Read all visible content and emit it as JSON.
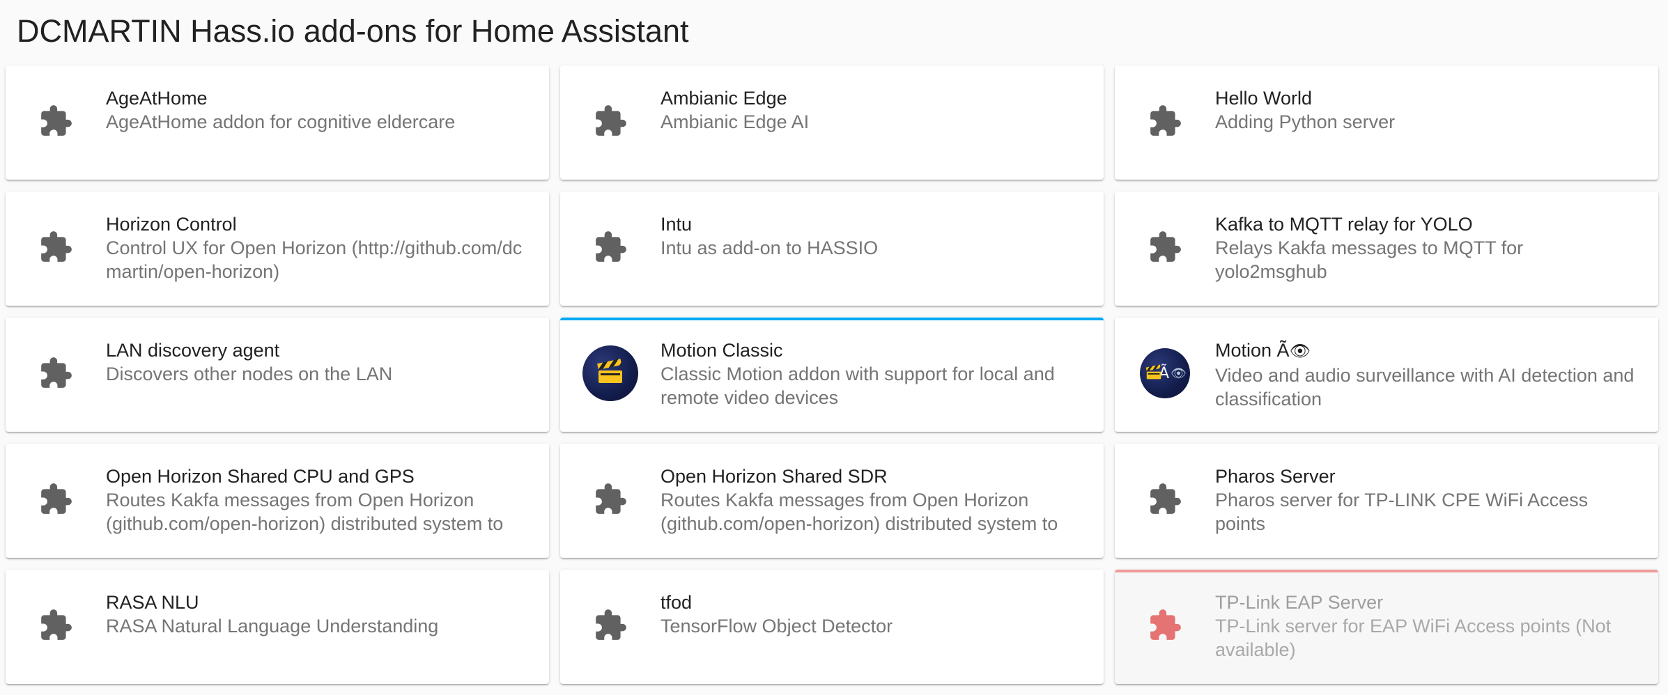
{
  "page": {
    "title": "DCMARTIN Hass.io add-ons for Home Assistant"
  },
  "colors": {
    "update_indicator": "#03a9f4",
    "unavailable_indicator": "#ef9a9a",
    "icon_default": "#616161",
    "icon_unavailable": "#e57373"
  },
  "addons": [
    {
      "name": "AgeAtHome",
      "description": "AgeAtHome addon for cognitive eldercare",
      "icon": "puzzle-icon"
    },
    {
      "name": "Ambianic Edge",
      "description": "Ambianic Edge AI",
      "icon": "puzzle-icon"
    },
    {
      "name": "Hello World",
      "description": "Adding Python server",
      "icon": "puzzle-icon"
    },
    {
      "name": "Horizon Control",
      "description": "Control UX for Open Horizon (http://github.com/dcmartin/open-horizon)",
      "icon": "puzzle-icon"
    },
    {
      "name": "Intu",
      "description": "Intu as add-on to HASSIO",
      "icon": "puzzle-icon"
    },
    {
      "name": "Kafka to MQTT relay for YOLO",
      "description": "Relays Kakfa messages to MQTT for yolo2msghub",
      "icon": "puzzle-icon"
    },
    {
      "name": "LAN discovery agent",
      "description": "Discovers other nodes on the LAN",
      "icon": "puzzle-icon"
    },
    {
      "name": "Motion Classic",
      "description": "Classic Motion addon with support for local and remote video devices",
      "icon": "motion-logo-icon",
      "status": "update-available"
    },
    {
      "name": "Motion Ã",
      "name_emoji": "👁",
      "description": "Video and audio surveillance with AI detection and classification",
      "icon": "motion-ai-logo-icon",
      "logo_text": "Ã",
      "logo_emoji": "👁"
    },
    {
      "name": "Open Horizon Shared CPU and GPS",
      "description": "Routes Kakfa messages from Open Horizon (github.com/open-horizon) distributed system to",
      "icon": "puzzle-icon"
    },
    {
      "name": "Open Horizon Shared SDR",
      "description": "Routes Kakfa messages from Open Horizon (github.com/open-horizon) distributed system to",
      "icon": "puzzle-icon"
    },
    {
      "name": "Pharos Server",
      "description": "Pharos server for TP-LINK CPE WiFi Access points",
      "icon": "puzzle-icon"
    },
    {
      "name": "RASA NLU",
      "description": "RASA Natural Language Understanding",
      "icon": "puzzle-icon"
    },
    {
      "name": "tfod",
      "description": "TensorFlow Object Detector",
      "icon": "puzzle-icon"
    },
    {
      "name": "TP-Link EAP Server",
      "description": "TP-Link server for EAP WiFi Access points (Not available)",
      "icon": "puzzle-icon",
      "status": "not-available"
    }
  ]
}
